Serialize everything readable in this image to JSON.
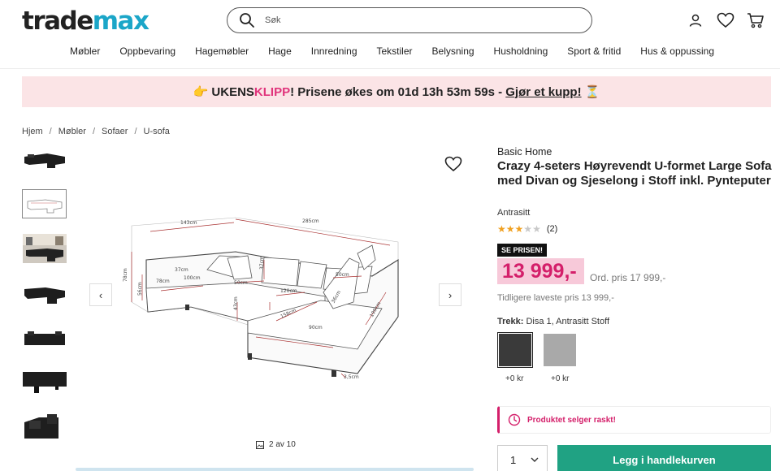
{
  "header": {
    "logo_part1": "trade",
    "logo_part2": "max",
    "search_placeholder": "Søk",
    "nav": [
      "Møbler",
      "Oppbevaring",
      "Hagemøbler",
      "Hage",
      "Innredning",
      "Tekstiler",
      "Belysning",
      "Husholdning",
      "Sport & fritid",
      "Hus & oppussing"
    ]
  },
  "banner": {
    "emoji_left": "👉",
    "text_a": "UKENS ",
    "text_klipp": "KLIPP",
    "text_b": "! Prisene økes om 01d 13h 53m 59s - ",
    "text_link": "Gjør et kupp!",
    "emoji_right": "⏳"
  },
  "breadcrumb": [
    "Hjem",
    "Møbler",
    "Sofaer",
    "U-sofa"
  ],
  "gallery": {
    "counter": "2 av 10",
    "current_index": 2,
    "total": 10,
    "prev_arrow": "‹",
    "next_arrow": "›",
    "dimensions": {
      "d143": "143cm",
      "d285": "285cm",
      "d78a": "78cm",
      "d78b": "78cm",
      "d100": "100cm",
      "d56": "56cm",
      "d37a": "37cm",
      "d37b": "37cm",
      "d50a": "50cm",
      "d50b": "50cm",
      "d43": "43cm",
      "d120": "120cm",
      "d36": "36cm",
      "d158": "158cm",
      "d199": "199cm",
      "d90": "90cm",
      "d35": "3,5cm"
    }
  },
  "product": {
    "brand": "Basic Home",
    "title": "Crazy 4-seters Høyrevendt U-formet Large Sofa med Divan og Sjeselong i Stoff inkl. Pynteputer",
    "color": "Antrasitt",
    "rating_value": 3,
    "rating_max": 5,
    "rating_count": "(2)",
    "badge": "SE PRISEN!",
    "price": "13 999,-",
    "ord_price": "Ord. pris 17 999,-",
    "lowest_price": "Tidligere laveste pris 13 999,-",
    "trekk_label": "Trekk:",
    "trekk_value": "Disa 1, Antrasitt Stoff",
    "swatches": [
      {
        "price": "+0 kr",
        "color": "#3a3a3a"
      },
      {
        "price": "+0 kr",
        "color": "#a9a9a9"
      }
    ],
    "urgency": "Produktet selger raskt!",
    "quantity": "1",
    "add_to_cart": "Legg i handlekurven"
  },
  "colors": {
    "brand_blue": "#1ba6c8",
    "accent_pink": "#d41f6a",
    "cart_green": "#20a283",
    "banner_bg": "#fbe4e6"
  }
}
